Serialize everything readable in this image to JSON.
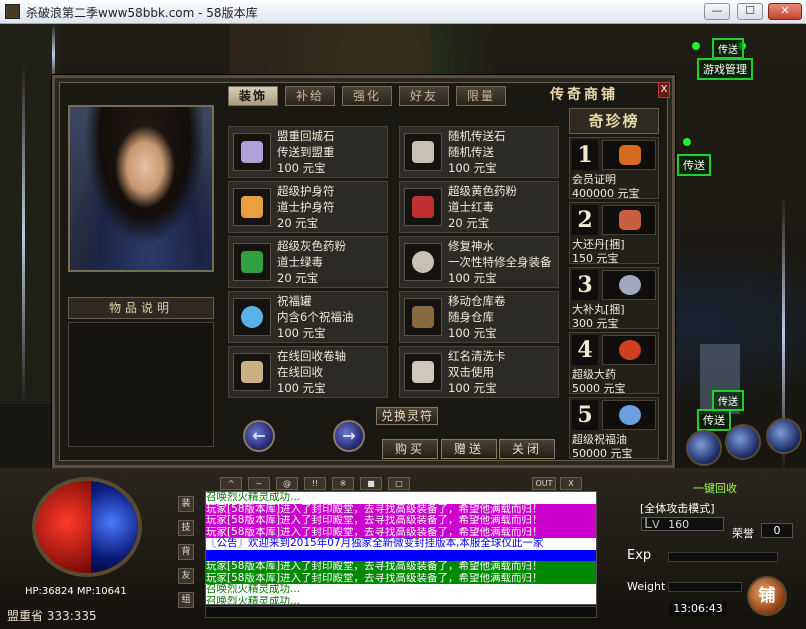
{
  "window": {
    "title": "杀破浪第二季www58bbk.com - 58版本库",
    "minimize": "—",
    "maximize": "☐",
    "close": "✕"
  },
  "npcs": [
    {
      "label": "传送"
    },
    {
      "label": "游戏管理"
    },
    {
      "label": "传送"
    },
    {
      "label": "传送"
    },
    {
      "label": "传送"
    }
  ],
  "shop": {
    "title": "传奇商铺",
    "close": "X",
    "tabs": [
      "装饰",
      "补给",
      "强化",
      "好友",
      "限量"
    ],
    "active_tab": "装饰",
    "portrait_label": "物品说明",
    "items_left": [
      {
        "name": "盟重回城石",
        "desc": "传送到盟重",
        "price": "100 元宝",
        "color": "#b0a0d8"
      },
      {
        "name": "超级护身符",
        "desc": "道士护身符",
        "price": "20 元宝",
        "color": "#e8a040"
      },
      {
        "name": "超级灰色药粉",
        "desc": "道士绿毒",
        "price": "20 元宝",
        "color": "#30a040"
      },
      {
        "name": "祝福罐",
        "desc": "内含6个祝福油",
        "price": "100 元宝",
        "color": "#5ab0e8"
      },
      {
        "name": "在线回收卷轴",
        "desc": "在线回收",
        "price": "100 元宝",
        "color": "#c8b080"
      }
    ],
    "items_right": [
      {
        "name": "随机传送石",
        "desc": "随机传送",
        "price": "100 元宝",
        "color": "#c8c0b0"
      },
      {
        "name": "超级黄色药粉",
        "desc": "道士红毒",
        "price": "20 元宝",
        "color": "#c03030"
      },
      {
        "name": "修复神水",
        "desc": "一次性特修全身装备",
        "price": "100 元宝",
        "color": "#c8c0b0"
      },
      {
        "name": "移动仓库卷",
        "desc": "随身仓库",
        "price": "100 元宝",
        "color": "#8a6a40"
      },
      {
        "name": "红名清洗卡",
        "desc": "双击使用",
        "price": "100 元宝",
        "color": "#d0c8b8"
      }
    ],
    "rare_header": "奇珍榜",
    "rare": [
      {
        "rank": "1",
        "name": "会员证明",
        "price": "400000  元宝",
        "color": "#d86a20"
      },
      {
        "rank": "2",
        "name": "大还丹[捆]",
        "price": "150  元宝",
        "color": "#c86040"
      },
      {
        "rank": "3",
        "name": "大补丸[捆]",
        "price": "300  元宝",
        "color": "#a0a8c0"
      },
      {
        "rank": "4",
        "name": "超级大药",
        "price": "5000  元宝",
        "color": "#d04020"
      },
      {
        "rank": "5",
        "name": "超级祝福油",
        "price": "50000  元宝",
        "color": "#6aa0e0"
      }
    ],
    "exchange_label": "兑换灵符",
    "prev": "←",
    "next": "→",
    "buy_label": "购买",
    "gift_label": "赠送",
    "close_label": "关闭"
  },
  "chat": {
    "lines": [
      {
        "text": "召唤烈火精灵成功...",
        "fg": "#007700",
        "bg": "#ffffff"
      },
      {
        "text": "玩家[58版本库]进入了封印殿堂，去寻找高级装备了，希望他满载而归！",
        "fg": "#ffffff",
        "bg": "#cc00cc"
      },
      {
        "text": "玩家[58版本库]进入了封印殿堂，去寻找高级装备了，希望他满载而归！",
        "fg": "#ffffff",
        "bg": "#cc00cc"
      },
      {
        "text": "玩家[58版本库]进入了封印殿堂，去寻找高级装备了，希望他满载而归！",
        "fg": "#ffffff",
        "bg": "#cc00cc"
      },
      {
        "text": "〖公告〗欢迎来到2015年07月独家全新微变封挂版本,本服全球仅此一家",
        "fg": "#0000ff",
        "bg": "#ffffff"
      },
      {
        "text": "",
        "fg": "#ffffff",
        "bg": "#0000ff"
      },
      {
        "text": "玩家[58版本库]进入了封印殿堂，去寻找高级装备了，希望他满载而归！",
        "fg": "#ffffff",
        "bg": "#008800"
      },
      {
        "text": "玩家[58版本库]进入了封印殿堂，去寻找高级装备了，希望他满载而归！",
        "fg": "#ffffff",
        "bg": "#008800"
      },
      {
        "text": "召唤烈火精灵成功...",
        "fg": "#007700",
        "bg": "#ffffff"
      },
      {
        "text": "召唤烈火精灵成功...",
        "fg": "#007700",
        "bg": "#ffffff"
      }
    ],
    "toolbar": [
      "^",
      "~",
      "@",
      "!!",
      "※",
      "■",
      "□",
      "OUT",
      "X"
    ]
  },
  "hud": {
    "hp_mp": "HP:36824  MP:10641",
    "location": "盟重省  333:335",
    "attack_mode": "[全体攻击模式]",
    "level_label": "Lv",
    "level_value": "160",
    "honor_label": "荣誉",
    "honor_value": "0",
    "exp_label": "Exp",
    "weight_label": "Weight",
    "clock": "13:06:43",
    "shop_button": "铺",
    "recycle": "一键回收",
    "side_icons": [
      "装",
      "技",
      "背",
      "友",
      "组"
    ]
  }
}
